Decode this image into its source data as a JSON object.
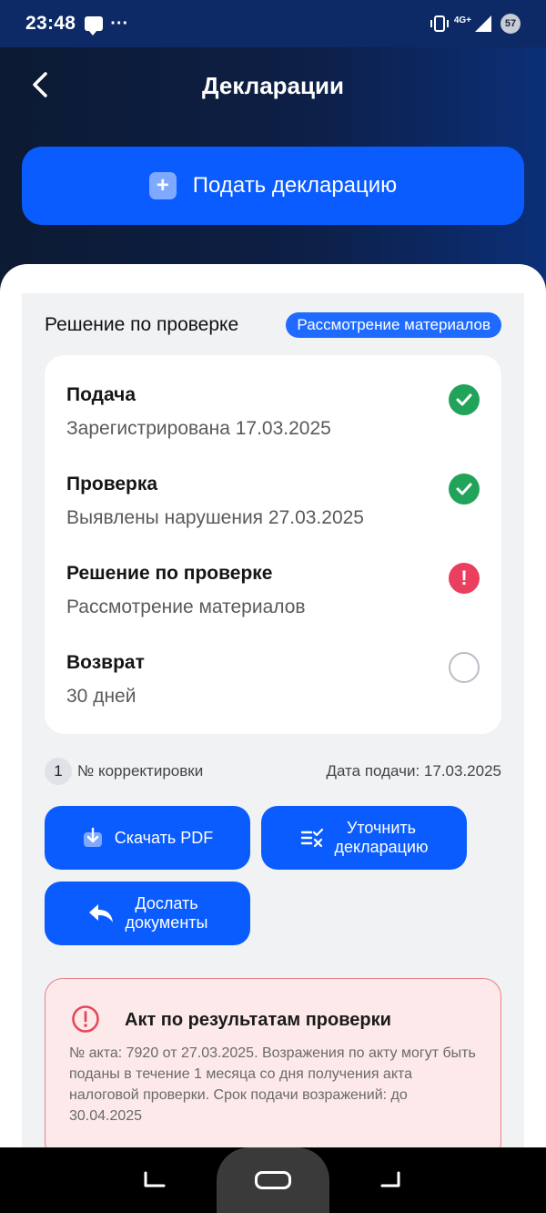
{
  "status_bar": {
    "time": "23:48",
    "dots": "···",
    "network": "4G+",
    "battery": "57"
  },
  "header": {
    "title": "Декларации"
  },
  "primary_action": {
    "plus": "+",
    "label": "Подать декларацию"
  },
  "section": {
    "title": "Решение по проверке",
    "badge": "Рассмотрение материалов"
  },
  "steps": [
    {
      "title": "Подача",
      "subtitle": "Зарегистрирована 17.03.2025",
      "state": "done"
    },
    {
      "title": "Проверка",
      "subtitle": "Выявлены нарушения 27.03.2025",
      "state": "done"
    },
    {
      "title": "Решение по проверке",
      "subtitle": "Рассмотрение материалов",
      "state": "error",
      "mark": "!"
    },
    {
      "title": "Возврат",
      "subtitle": "30 дней",
      "state": "pending"
    }
  ],
  "meta": {
    "correction_number": "1",
    "correction_label": "№ корректировки",
    "submit_date": "Дата подачи: 17.03.2025"
  },
  "actions": {
    "download_pdf": "Скачать PDF",
    "refine_line1": "Уточнить",
    "refine_line2": "декларацию",
    "send_line1": "Дослать",
    "send_line2": "документы"
  },
  "alert": {
    "title": "Акт по результатам проверки",
    "body": "№ акта: 7920 от 27.03.2025. Возражения по акту могут быть поданы в течение 1 месяца со дня получения акта налоговой проверки. Срок подачи возражений: до 30.04.2025"
  },
  "colors": {
    "accent": "#0a5cff",
    "success": "#21a35a",
    "error": "#ea3f5f",
    "alert_bg": "#fde9ea"
  }
}
